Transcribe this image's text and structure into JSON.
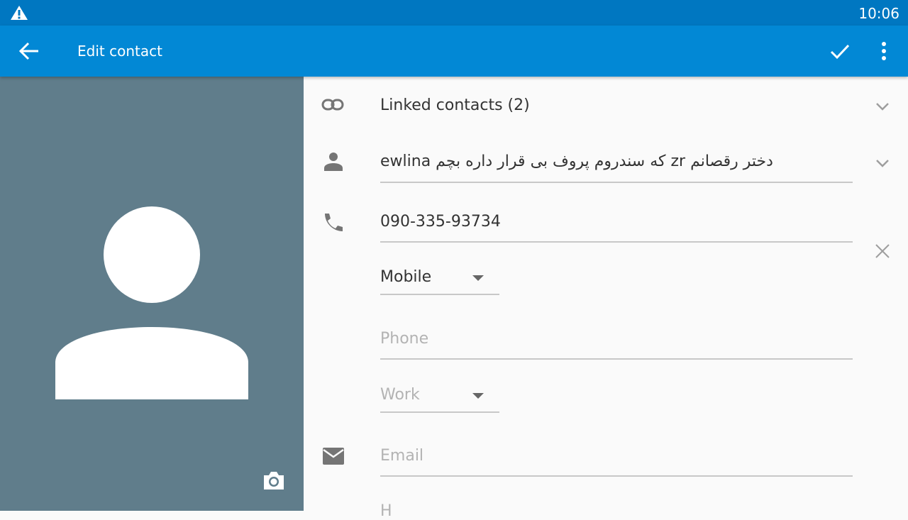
{
  "status_bar": {
    "time": "10:06",
    "warning_icon": "warning-icon"
  },
  "app_bar": {
    "title": "Edit contact",
    "back_icon": "arrow-back-icon",
    "save_icon": "check-icon",
    "more_icon": "more-vert-icon",
    "color": "#0288d5"
  },
  "photo": {
    "background": "#607d8b",
    "camera_icon": "camera-icon"
  },
  "form": {
    "linked_contacts": "Linked contacts (2)",
    "name": "ewlina که سندروم پروف بی قرار داره بچم zr دختر رقصانم",
    "phone_value": "090-335-93734",
    "phone_type": "Mobile",
    "phone_placeholder": "Phone",
    "phone2_type": "Work",
    "email_placeholder": "Email",
    "address_placeholder_partial": "H"
  }
}
